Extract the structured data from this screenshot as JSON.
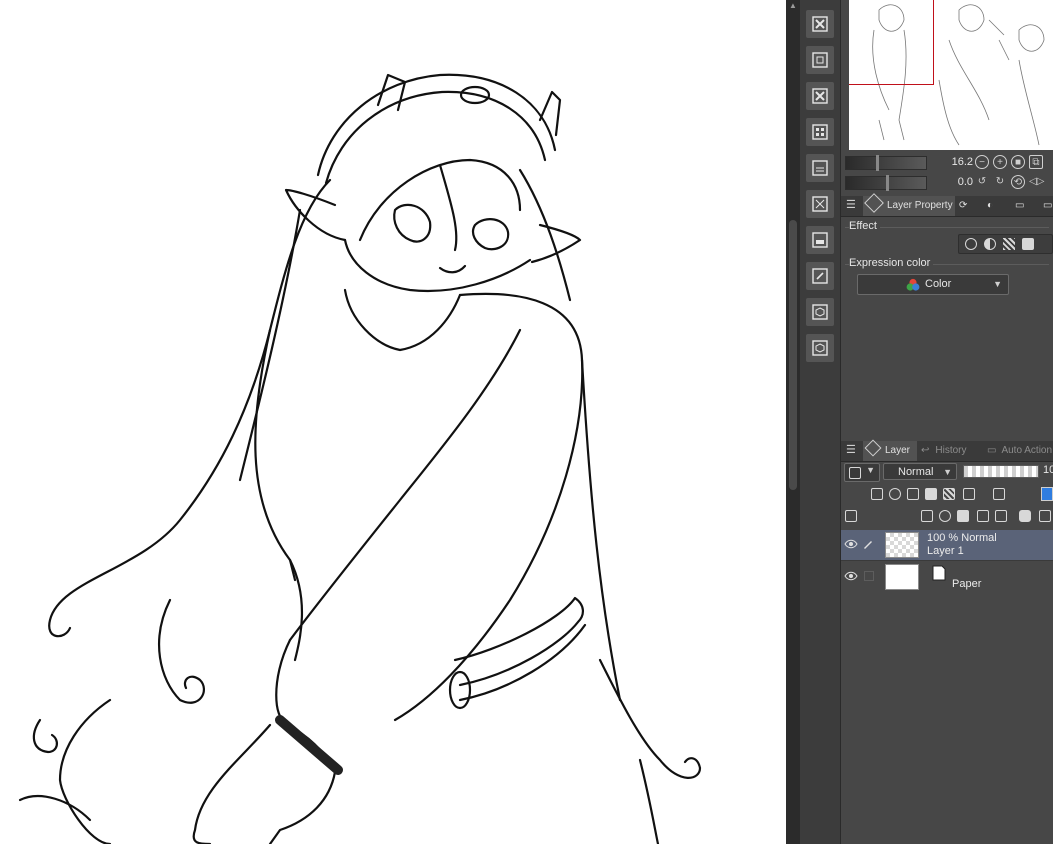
{
  "navigator": {
    "zoom_value": "16.2",
    "rotate_value": "0.0"
  },
  "property_panel": {
    "tab_label": "Layer Property",
    "effect_label": "Effect",
    "expression_color_label": "Expression color",
    "color_value": "Color"
  },
  "layer_panel": {
    "tabs": [
      {
        "label": "Layer",
        "active": true
      },
      {
        "label": "History",
        "active": false
      },
      {
        "label": "Auto Action",
        "active": false
      }
    ],
    "blend_mode": "Normal",
    "opacity_display": "10",
    "layers": [
      {
        "line1": "100 % Normal",
        "line2": "Layer 1",
        "selected": true
      },
      {
        "line1": "",
        "line2": "Paper",
        "selected": false
      }
    ]
  },
  "colors": {
    "panel_bg": "#474747",
    "selected_layer": "#5a6378",
    "navigator_frame": "#c0101a"
  }
}
